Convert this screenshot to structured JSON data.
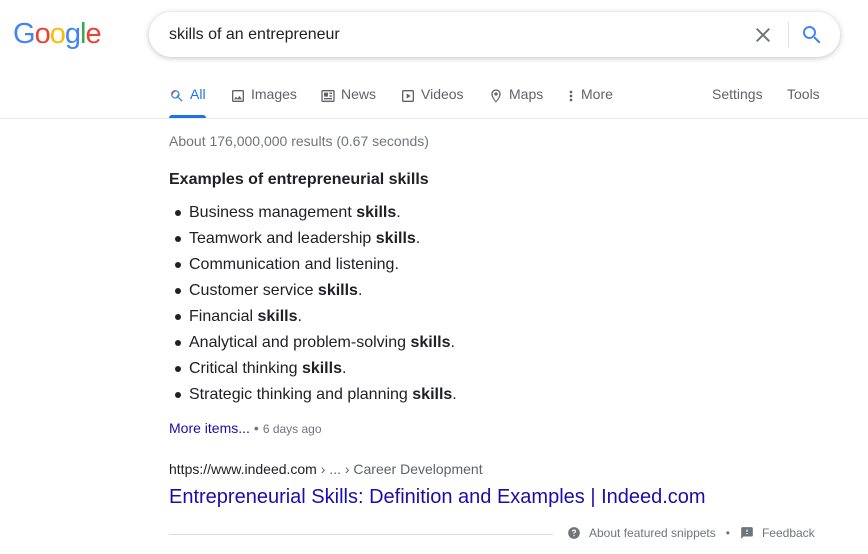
{
  "logo": {
    "letters": [
      "G",
      "o",
      "o",
      "g",
      "l",
      "e"
    ],
    "colors": [
      "#4285F4",
      "#EA4335",
      "#FBBC05",
      "#4285F4",
      "#34A853",
      "#EA4335"
    ]
  },
  "search": {
    "query": "skills of an entrepreneur"
  },
  "tabs": [
    {
      "label": "All",
      "icon": "search-icon",
      "active": true
    },
    {
      "label": "Images",
      "icon": "image-icon"
    },
    {
      "label": "News",
      "icon": "news-icon"
    },
    {
      "label": "Videos",
      "icon": "video-icon"
    },
    {
      "label": "Maps",
      "icon": "map-pin-icon"
    },
    {
      "label": "More",
      "icon": "more-vert-icon"
    }
  ],
  "tools": {
    "settings": "Settings",
    "tools": "Tools"
  },
  "stats": "About 176,000,000 results (0.67 seconds)",
  "snippet": {
    "title": "Examples of entrepreneurial skills",
    "items": [
      {
        "text": "Business management ",
        "bold": "skills",
        "tail": "."
      },
      {
        "text": "Teamwork and leadership ",
        "bold": "skills",
        "tail": "."
      },
      {
        "text": "Communication and listening.",
        "bold": "",
        "tail": ""
      },
      {
        "text": "Customer service ",
        "bold": "skills",
        "tail": "."
      },
      {
        "text": "Financial ",
        "bold": "skills",
        "tail": "."
      },
      {
        "text": "Analytical and problem-solving ",
        "bold": "skills",
        "tail": "."
      },
      {
        "text": "Critical thinking ",
        "bold": "skills",
        "tail": "."
      },
      {
        "text": "Strategic thinking and planning ",
        "bold": "skills",
        "tail": "."
      }
    ],
    "more_items": "More items...",
    "dot": "•",
    "age": "6 days ago"
  },
  "result": {
    "url": "https://www.indeed.com",
    "breadcrumb": " › ... › Career Development",
    "title": "Entrepreneurial Skills: Definition and Examples | Indeed.com"
  },
  "footer": {
    "about": "About featured snippets",
    "sep": "•",
    "feedback": "Feedback"
  }
}
